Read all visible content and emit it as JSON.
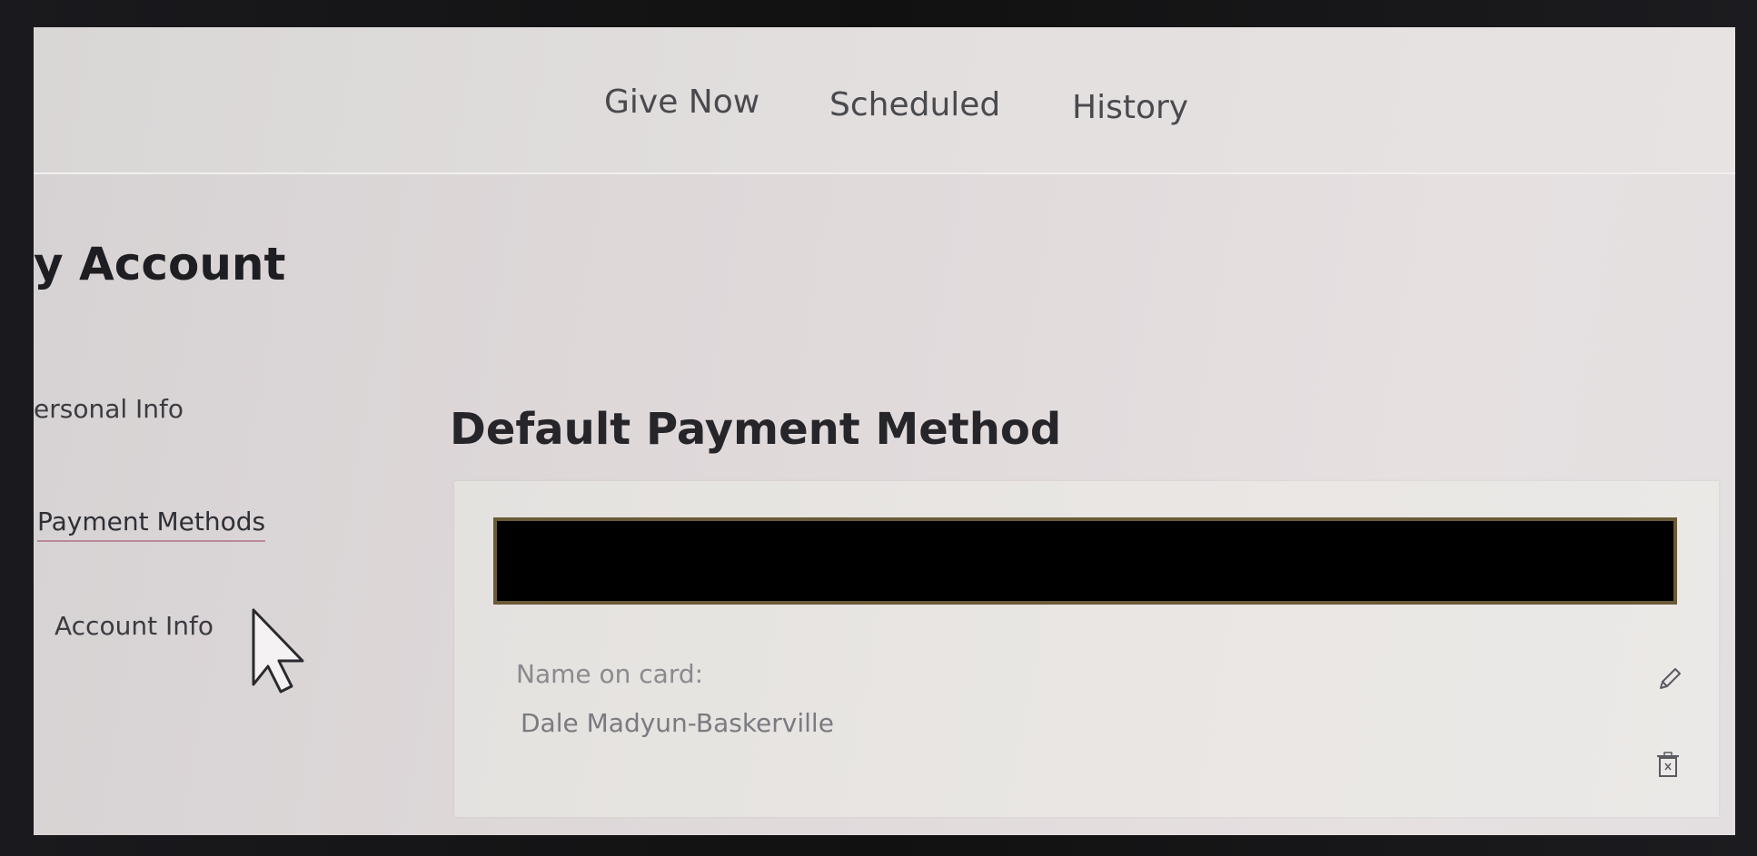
{
  "nav": {
    "tabs": [
      {
        "label": "Give Now"
      },
      {
        "label": "Scheduled"
      },
      {
        "label": "History"
      }
    ]
  },
  "page": {
    "title": "y Account"
  },
  "sidebar": {
    "items": [
      {
        "label": "ersonal Info",
        "active": false
      },
      {
        "label": "Payment Methods",
        "active": true
      },
      {
        "label": "Account Info",
        "active": false
      }
    ]
  },
  "main": {
    "section_title": "Default Payment Method",
    "card": {
      "name_label": "Name on card:",
      "name_value": "Dale Madyun-Baskerville",
      "edit_icon": "pencil-icon",
      "delete_icon": "trash-icon"
    }
  },
  "colors": {
    "active_underline": "#b88a9b",
    "redaction_border": "#6b5a36"
  }
}
